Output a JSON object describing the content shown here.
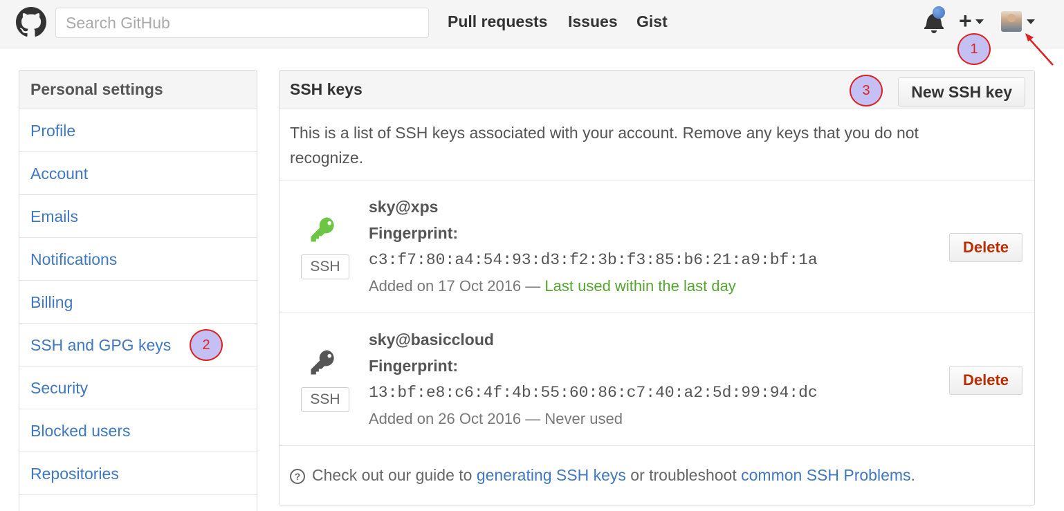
{
  "header": {
    "search_placeholder": "Search GitHub",
    "nav": [
      "Pull requests",
      "Issues",
      "Gist"
    ],
    "plus_label": "+"
  },
  "callouts": [
    "1",
    "2",
    "3"
  ],
  "sidebar": {
    "title": "Personal settings",
    "items": [
      {
        "label": "Profile"
      },
      {
        "label": "Account"
      },
      {
        "label": "Emails"
      },
      {
        "label": "Notifications"
      },
      {
        "label": "Billing"
      },
      {
        "label": "SSH and GPG keys"
      },
      {
        "label": "Security"
      },
      {
        "label": "Blocked users"
      },
      {
        "label": "Repositories"
      }
    ]
  },
  "main": {
    "title": "SSH keys",
    "new_button": "New SSH key",
    "intro": "This is a list of SSH keys associated with your account. Remove any keys that you do not recognize.",
    "keys": [
      {
        "name": "sky@xps",
        "fingerprint_label": "Fingerprint:",
        "fingerprint": "c3:f7:80:a4:54:93:d3:f2:3b:f3:85:b6:21:a9:bf:1a",
        "added": "Added on 17 Oct 2016 —",
        "last_used": "Last used within the last day",
        "badge": "SSH",
        "delete_label": "Delete",
        "icon_color": "#6cc644"
      },
      {
        "name": "sky@basiccloud",
        "fingerprint_label": "Fingerprint:",
        "fingerprint": "13:bf:e8:c6:4f:4b:55:60:86:c7:40:a2:5d:99:94:dc",
        "added": "Added on 26 Oct 2016 —",
        "last_used": "Never used",
        "badge": "SSH",
        "delete_label": "Delete",
        "icon_color": "#555555"
      }
    ],
    "footer": {
      "q_mark": "?",
      "text_before": "Check out our guide to",
      "link1": "generating SSH keys",
      "text_middle": "or troubleshoot",
      "link2": "common SSH Problems",
      "text_after": "."
    }
  },
  "colors": {
    "link": "#4078c0",
    "danger": "#bd2c00",
    "success": "#55a532",
    "callout_fill": "#c5c0f3",
    "callout_border": "#dd2222"
  }
}
